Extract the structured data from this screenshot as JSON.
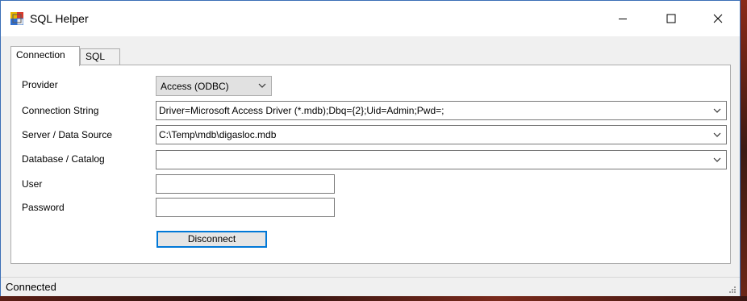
{
  "window": {
    "title": "SQL Helper",
    "controls": {
      "minimize": "minimize-icon",
      "maximize": "maximize-icon",
      "close": "close-icon"
    }
  },
  "tabs": [
    {
      "label": "Connection",
      "active": true
    },
    {
      "label": "SQL",
      "active": false
    }
  ],
  "form": {
    "provider": {
      "label": "Provider",
      "value": "Access (ODBC)"
    },
    "connection_string": {
      "label": "Connection String",
      "value": "Driver=Microsoft Access Driver (*.mdb);Dbq={2};Uid=Admin;Pwd=;"
    },
    "server": {
      "label": "Server / Data Source",
      "value": "C:\\Temp\\mdb\\digasloc.mdb"
    },
    "database": {
      "label": "Database / Catalog",
      "value": ""
    },
    "user": {
      "label": "User",
      "value": ""
    },
    "password": {
      "label": "Password",
      "value": ""
    },
    "disconnect_label": "Disconnect"
  },
  "status": {
    "text": "Connected"
  },
  "colors": {
    "accent": "#0078d7",
    "window_border": "#3b6fb6",
    "panel": "#ffffff",
    "chrome": "#f0f0f0"
  }
}
